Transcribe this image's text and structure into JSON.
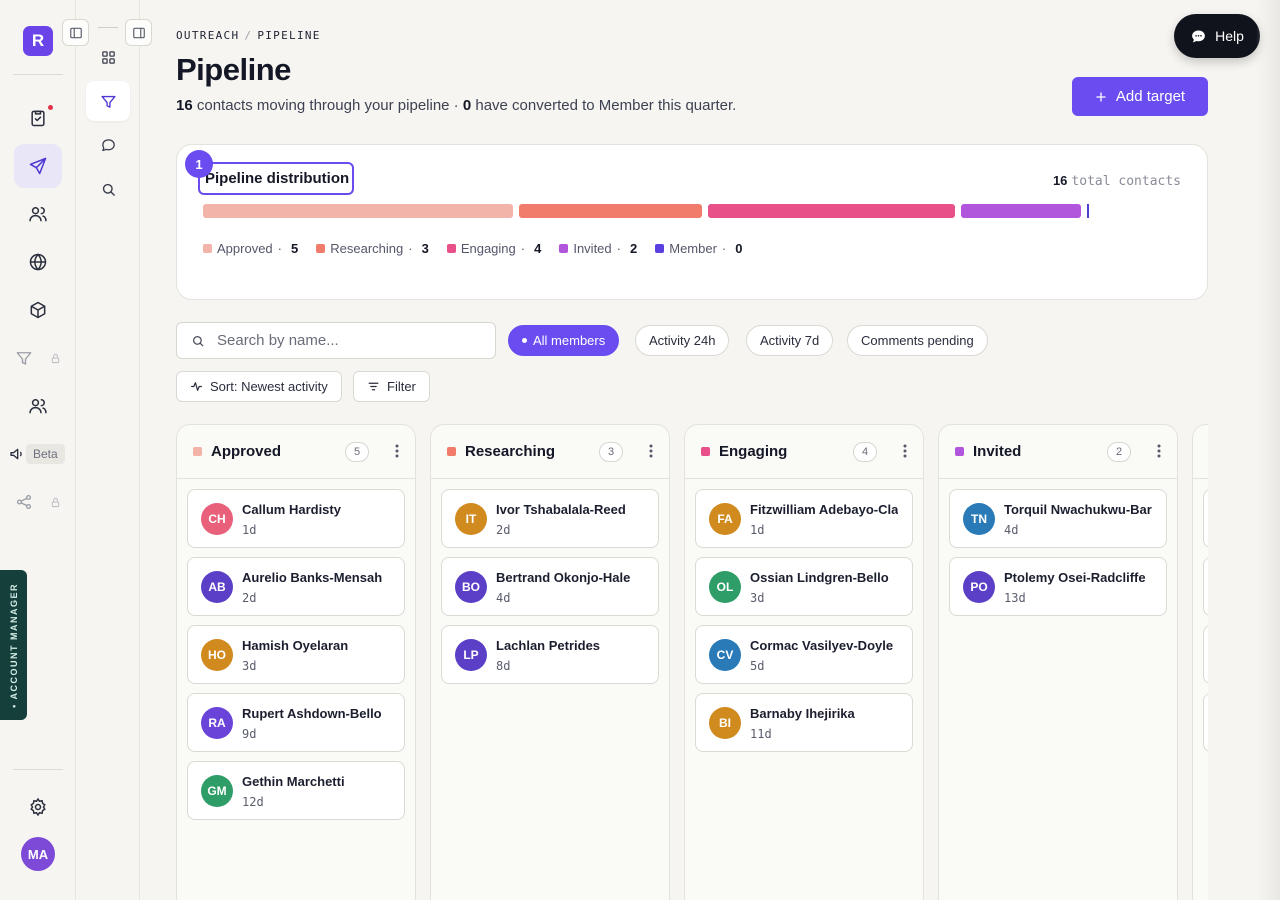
{
  "rail": {
    "logo_letter": "R",
    "beta_label": "Beta",
    "account_manager_label": "• ACCOUNT MANAGER",
    "user_initials": "MA"
  },
  "breadcrumb": {
    "parent": "OUTREACH",
    "current": "PIPELINE"
  },
  "page": {
    "title": "Pipeline",
    "subtitle_count": "16",
    "subtitle_text_1": "contacts moving through your pipeline ·",
    "subtitle_converted": "0",
    "subtitle_text_2": "have converted to Member this quarter."
  },
  "actions": {
    "add_target_label": "Add target",
    "help_label": "Help"
  },
  "distribution": {
    "step_number": "1",
    "title": "Pipeline distribution",
    "total_count": "16",
    "total_label": "total contacts",
    "stages": [
      {
        "name": "Approved",
        "count": 5,
        "color": "#f2b4a8"
      },
      {
        "name": "Researching",
        "count": 3,
        "color": "#f27c6c"
      },
      {
        "name": "Engaging",
        "count": 4,
        "color": "#e8508a"
      },
      {
        "name": "Invited",
        "count": 2,
        "color": "#b055dc"
      },
      {
        "name": "Member",
        "count": 0,
        "color": "#5b3fe0"
      }
    ]
  },
  "filters": {
    "search_placeholder": "Search by name...",
    "chips": [
      "All members",
      "Activity 24h",
      "Activity 7d",
      "Comments pending"
    ],
    "sort_label": "Sort: Newest activity",
    "filter_label": "Filter"
  },
  "columns": [
    {
      "title": "Approved",
      "count": "5",
      "color": "#f2b4a8",
      "cards": [
        {
          "initials": "CH",
          "name": "Callum Hardisty",
          "age": "1d",
          "color": "#e8607a"
        },
        {
          "initials": "AB",
          "name": "Aurelio Banks-Mensah",
          "age": "2d",
          "color": "#5b3fc6"
        },
        {
          "initials": "HO",
          "name": "Hamish Oyelaran",
          "age": "3d",
          "color": "#d08a1e"
        },
        {
          "initials": "RA",
          "name": "Rupert Ashdown-Bello",
          "age": "9d",
          "color": "#6a44d8"
        },
        {
          "initials": "GM",
          "name": "Gethin Marchetti",
          "age": "12d",
          "color": "#2e9d68"
        }
      ]
    },
    {
      "title": "Researching",
      "count": "3",
      "color": "#f27c6c",
      "cards": [
        {
          "initials": "IT",
          "name": "Ivor Tshabalala-Reed",
          "age": "2d",
          "color": "#d08a1e"
        },
        {
          "initials": "BO",
          "name": "Bertrand Okonjo-Hale",
          "age": "4d",
          "color": "#5b3fc6"
        },
        {
          "initials": "LP",
          "name": "Lachlan Petrides",
          "age": "8d",
          "color": "#5b3fc6"
        }
      ]
    },
    {
      "title": "Engaging",
      "count": "4",
      "color": "#e8508a",
      "cards": [
        {
          "initials": "FA",
          "name": "Fitzwilliam Adebayo-Clarke",
          "age": "1d",
          "color": "#d08a1e"
        },
        {
          "initials": "OL",
          "name": "Ossian Lindgren-Bello",
          "age": "3d",
          "color": "#2e9d68"
        },
        {
          "initials": "CV",
          "name": "Cormac Vasilyev-Doyle",
          "age": "5d",
          "color": "#2a7ab8"
        },
        {
          "initials": "BI",
          "name": "Barnaby Ihejirika",
          "age": "11d",
          "color": "#d08a1e"
        }
      ]
    },
    {
      "title": "Invited",
      "count": "2",
      "color": "#b055dc",
      "cards": [
        {
          "initials": "TN",
          "name": "Torquil Nwachukwu-Barnes",
          "age": "4d",
          "color": "#2a7ab8"
        },
        {
          "initials": "PO",
          "name": "Ptolemy Osei-Radcliffe",
          "age": "13d",
          "color": "#5b3fc6"
        }
      ]
    }
  ]
}
